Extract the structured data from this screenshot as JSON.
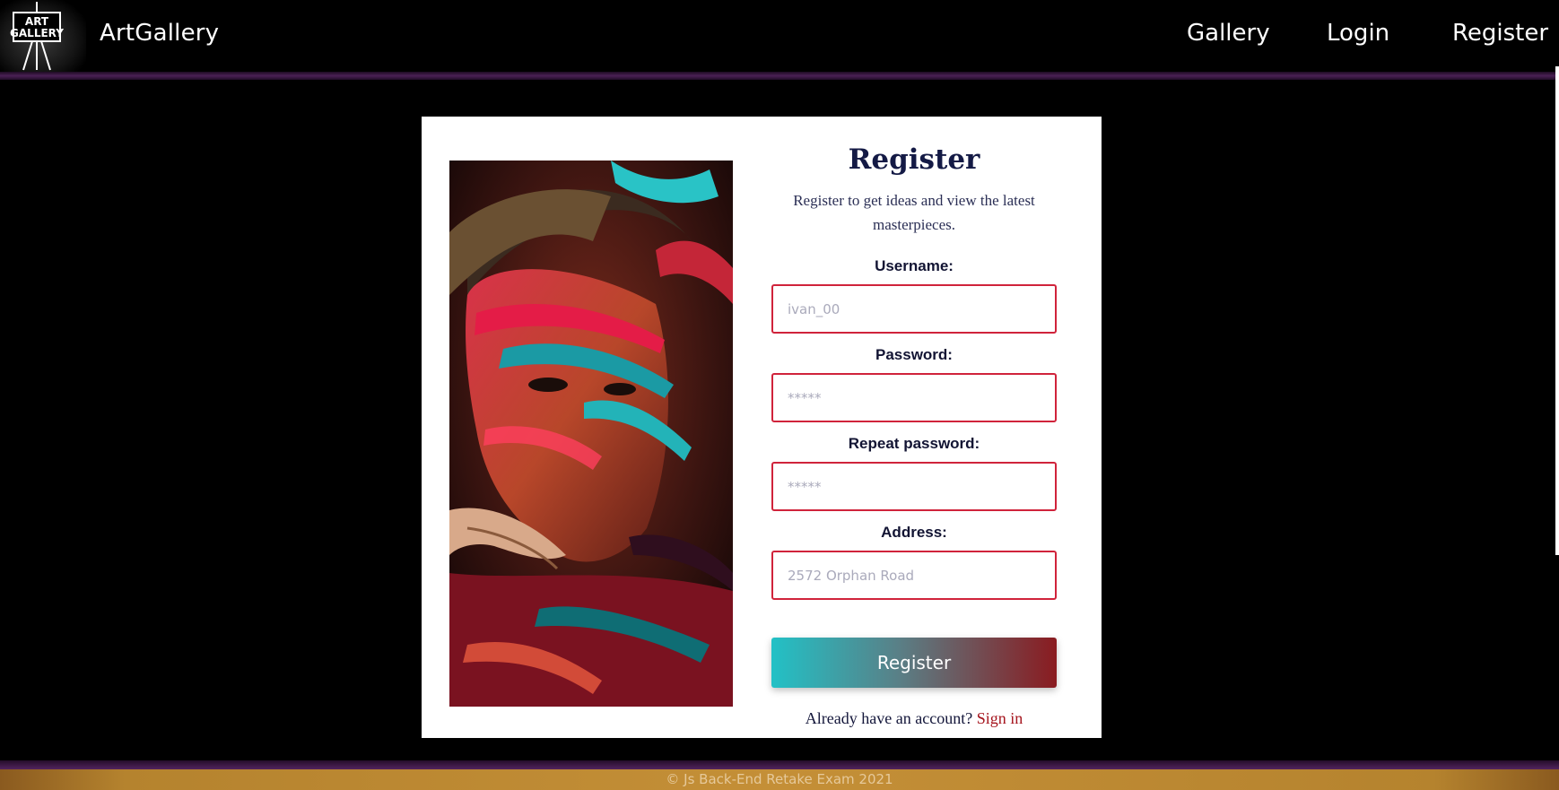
{
  "header": {
    "logo_text": "ART GALLERY",
    "brand": "ArtGallery",
    "nav": {
      "gallery": "Gallery",
      "login": "Login",
      "register": "Register"
    }
  },
  "form": {
    "title": "Register",
    "subtitle": "Register to get ideas and view the latest masterpieces.",
    "username_label": "Username:",
    "username_placeholder": "ivan_00",
    "password_label": "Password:",
    "password_placeholder": "*****",
    "repeat_label": "Repeat password:",
    "repeat_placeholder": "*****",
    "address_label": "Address:",
    "address_placeholder": "2572 Orphan Road",
    "submit_label": "Register",
    "signin_prompt": "Already have an account?",
    "signin_link": "Sign in"
  },
  "footer": {
    "text": "© Js Back-End Retake Exam 2021"
  },
  "colors": {
    "field_border": "#d0233b",
    "button_start": "#22c1c6",
    "button_end": "#8a1b20",
    "link": "#a5141d",
    "footer_bg": "#c48f37",
    "divider": "#4a2155"
  },
  "icons": {
    "logo": "easel-logo-icon",
    "art": "painted-face-artwork"
  }
}
